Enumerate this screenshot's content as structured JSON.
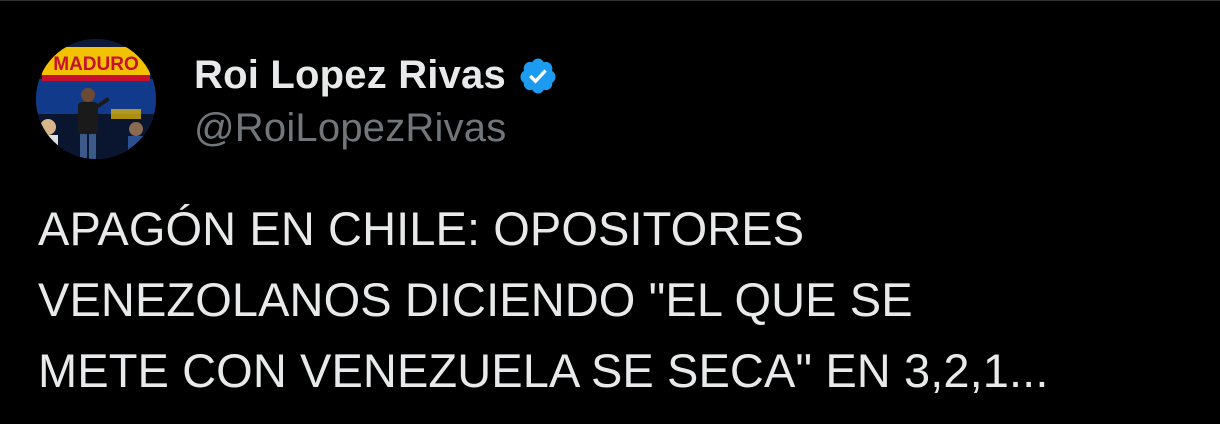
{
  "user": {
    "display_name": "Roi Lopez Rivas",
    "handle": "@RoiLopezRivas",
    "verified": true,
    "avatar_sign_text": "MADURO"
  },
  "tweet": {
    "text": "APAGÓN EN CHILE: OPOSITORES\nVENEZOLANOS DICIENDO \"EL QUE SE\nMETE CON VENEZUELA SE SECA\" EN 3,2,1..."
  },
  "colors": {
    "background": "#000000",
    "text_primary": "#e7e9ea",
    "text_secondary": "#71767b",
    "verified_badge": "#1d9bf0"
  },
  "icons": {
    "verified": "verified-badge-icon"
  }
}
